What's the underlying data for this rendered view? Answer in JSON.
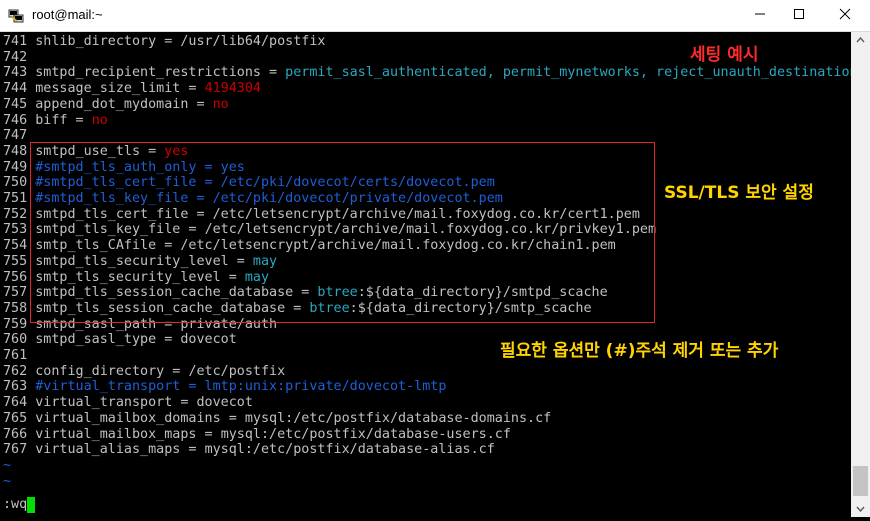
{
  "window": {
    "title": "root@mail:~",
    "minimize_glyph": "—",
    "maximize_glyph": "☐",
    "close_glyph": "✕",
    "app_icon": "putty-terminal-icon"
  },
  "terminal": {
    "lines": [
      {
        "n": "741",
        "key": "shlib_directory = ",
        "val": "/usr/lib64/postfix",
        "style": "key"
      },
      {
        "n": "742",
        "key": "",
        "val": "",
        "style": "key"
      },
      {
        "n": "743",
        "key": "smtpd_recipient_restrictions = ",
        "val": "permit_sasl_authenticated, permit_mynetworks, reject_unauth_destination",
        "style": "val-cyan"
      },
      {
        "n": "744",
        "key": "message_size_limit = ",
        "val": "4194304",
        "style": "val-red"
      },
      {
        "n": "745",
        "key": "append_dot_mydomain = ",
        "val": "no",
        "style": "val-red"
      },
      {
        "n": "746",
        "key": "biff = ",
        "val": "no",
        "style": "val-red"
      },
      {
        "n": "747",
        "key": "",
        "val": "",
        "style": "key"
      },
      {
        "n": "748",
        "key": "smtpd_use_tls = ",
        "val": "yes",
        "style": "val-red"
      },
      {
        "n": "749",
        "key": "",
        "val": "#smtpd_tls_auth_only = yes",
        "style": "comment"
      },
      {
        "n": "750",
        "key": "",
        "val": "#smtpd_tls_cert_file = /etc/pki/dovecot/certs/dovecot.pem",
        "style": "comment"
      },
      {
        "n": "751",
        "key": "",
        "val": "#smtpd_tls_key_file = /etc/pki/dovecot/private/dovecot.pem",
        "style": "comment"
      },
      {
        "n": "752",
        "key": "smtpd_tls_cert_file = ",
        "val": "/etc/letsencrypt/archive/mail.foxydog.co.kr/cert1.pem",
        "style": "key"
      },
      {
        "n": "753",
        "key": "smtpd_tls_key_file = ",
        "val": "/etc/letsencrypt/archive/mail.foxydog.co.kr/privkey1.pem",
        "style": "key"
      },
      {
        "n": "754",
        "key": "smtp_tls_CAfile = ",
        "val": "/etc/letsencrypt/archive/mail.foxydog.co.kr/chain1.pem",
        "style": "key"
      },
      {
        "n": "755",
        "key": "smtpd_tls_security_level = ",
        "val": "may",
        "style": "val-cyan"
      },
      {
        "n": "756",
        "key": "smtp_tls_security_level = ",
        "val": "may",
        "style": "val-cyan"
      },
      {
        "n": "757",
        "key": "smtpd_tls_session_cache_database = ",
        "val": "btree",
        "style": "val-cyan",
        "rest": ":${data_directory}/smtpd_scache"
      },
      {
        "n": "758",
        "key": "smtp_tls_session_cache_database = ",
        "val": "btree",
        "style": "val-cyan",
        "rest": ":${data_directory}/smtp_scache"
      },
      {
        "n": "759",
        "key": "smtpd_sasl_path = ",
        "val": "private/auth",
        "style": "key"
      },
      {
        "n": "760",
        "key": "smtpd_sasl_type = ",
        "val": "dovecot",
        "style": "key"
      },
      {
        "n": "761",
        "key": "",
        "val": "",
        "style": "key"
      },
      {
        "n": "762",
        "key": "config_directory = ",
        "val": "/etc/postfix",
        "style": "key"
      },
      {
        "n": "763",
        "key": "",
        "val": "#virtual_transport = lmtp:unix:private/dovecot-lmtp",
        "style": "comment"
      },
      {
        "n": "764",
        "key": "virtual_transport = ",
        "val": "dovecot",
        "style": "key"
      },
      {
        "n": "765",
        "key": "virtual_mailbox_domains = ",
        "val": "mysql:/etc/postfix/database-domains.cf",
        "style": "key"
      },
      {
        "n": "766",
        "key": "virtual_mailbox_maps = ",
        "val": "mysql:/etc/postfix/database-users.cf",
        "style": "key"
      },
      {
        "n": "767",
        "key": "virtual_alias_maps = ",
        "val": "mysql:/etc/postfix/database-alias.cf",
        "style": "key"
      }
    ],
    "tilde_lines": [
      "~",
      "~"
    ],
    "command": ":wq"
  },
  "annotations": {
    "example": "세팅 예시",
    "ssl": "SSL/TLS 보안 설정",
    "options": "필요한 옵션만 (#)주석 제거 또는 추가"
  },
  "colors": {
    "background": "#000000",
    "text": "#c0c0c0",
    "value_red": "#cc0000",
    "value_cyan": "#2aa8c0",
    "comment_blue": "#1e5fd6",
    "annotation_red": "#ff2a2a",
    "annotation_yellow": "#ffd400",
    "cursor_green": "#00e000"
  }
}
